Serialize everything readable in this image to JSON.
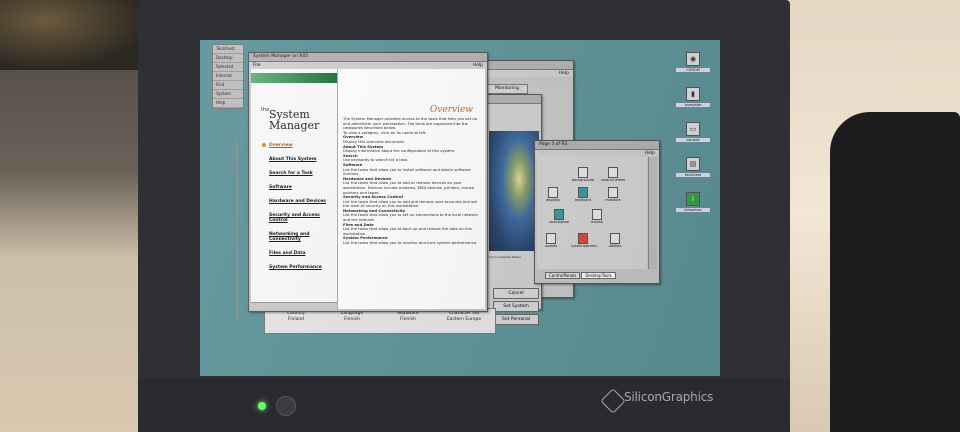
{
  "toolchest": {
    "items": [
      "Toolchest",
      "Desktop",
      "Selected",
      "Internet",
      "Find",
      "System",
      "Help"
    ]
  },
  "desktop_icons": [
    {
      "label": "CDROM",
      "icon": "cdrom-icon"
    },
    {
      "label": "dumpster",
      "icon": "dumpster-icon"
    },
    {
      "label": "console",
      "icon": "console-icon"
    },
    {
      "label": "toolchest",
      "icon": "folder-icon"
    },
    {
      "label": "Infoserver",
      "icon": "info-icon"
    }
  ],
  "system_manager": {
    "window_title": "System Manager on R05",
    "menu_file": "File",
    "menu_help": "Help",
    "logo_prefix": "the",
    "logo_line1": "System",
    "logo_line2": "Manager",
    "nav": [
      {
        "label": "Overview",
        "active": true
      },
      {
        "label": "About This System"
      },
      {
        "label": "Search for a Task"
      },
      {
        "label": "Software"
      },
      {
        "label": "Hardware and Devices"
      },
      {
        "label": "Security and Access Control"
      },
      {
        "label": "Networking and Connectivity"
      },
      {
        "label": "Files and Data"
      },
      {
        "label": "System Performance"
      }
    ],
    "heading": "Overview",
    "intro": "The System Manager provides access to the tools that help you set up and administer your workstation. The tools are organized into the categories described below.",
    "intro2": "To view a category, click on its name at left.",
    "sections": [
      {
        "title": "Overview",
        "text": "Display this overview document."
      },
      {
        "title": "About This System",
        "text": "Display information about the configuration of this system."
      },
      {
        "title": "Search",
        "text": "Use keywords to search for a task."
      },
      {
        "title": "Software",
        "text": "List the tasks that allow you to install software and obtain software licenses."
      },
      {
        "title": "Hardware and Devices",
        "text": "List the tasks that allow you to add or remove devices on your workstation. Devices include modems, MIDI devices, printers, mouse pointers and tapes."
      },
      {
        "title": "Security and Access Control",
        "text": "List the tasks that allow you to add and remove user accounts and set the level of security on this workstation."
      },
      {
        "title": "Networking and Connectivity",
        "text": "List the tasks that allow you to set up connections to the local network and the Internet."
      },
      {
        "title": "Files and Data",
        "text": "List the tasks that allow you to back up and restore the data on this workstation."
      },
      {
        "title": "System Performance",
        "text": "List the tasks that allow you to monitor and tune system performance."
      }
    ]
  },
  "background_window": {
    "menu_help": "Help",
    "tab_label": "Monitoring"
  },
  "earth_window": {
    "caption": "Tie to Satellite Netwo"
  },
  "icon_catalog": {
    "title": "Page 3 of RS",
    "menu_help": "Help",
    "icons": [
      {
        "label": "backgrounds",
        "style": "plain"
      },
      {
        "label": "colorschemes",
        "style": "plain"
      },
      {
        "label": "displays",
        "style": "plain"
      },
      {
        "label": "keyboard",
        "style": "teal"
      },
      {
        "label": "monitors",
        "style": "plain"
      },
      {
        "label": "soundpanel",
        "style": "teal"
      },
      {
        "label": "mouse",
        "style": "plain"
      },
      {
        "label": "sounds",
        "style": "plain"
      },
      {
        "label": "systemparams",
        "style": "red"
      },
      {
        "label": "utilities",
        "style": "plain"
      }
    ],
    "tabs": [
      "ControlPanels",
      "DesktopTools"
    ]
  },
  "side_buttons": [
    "Cancel",
    "Set System",
    "Set Personal"
  ],
  "language_strip": [
    {
      "head": "Country",
      "value": "Finland"
    },
    {
      "head": "Language",
      "value": "Finnish"
    },
    {
      "head": "Keyboard",
      "value": "Finnish"
    },
    {
      "head": "Character set",
      "value": "Eastern Europe"
    }
  ],
  "brand": "SiliconGraphics"
}
